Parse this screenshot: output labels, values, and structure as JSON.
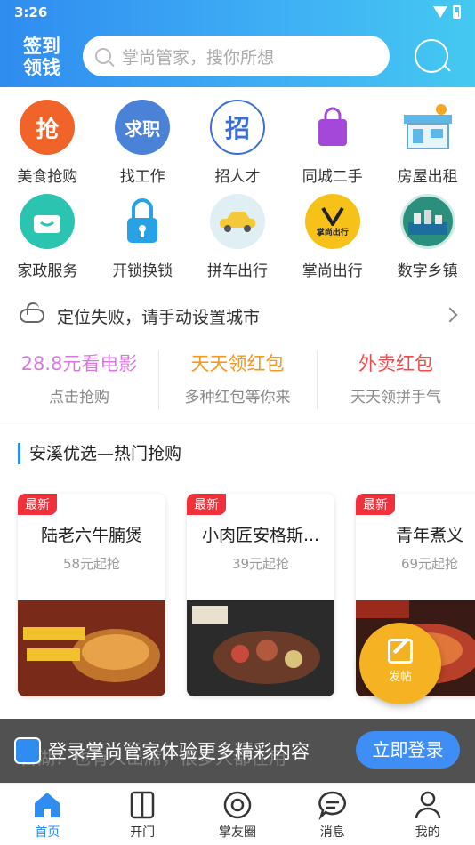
{
  "status": {
    "time": "3:26"
  },
  "header": {
    "signin_label": "签到领钱",
    "search_placeholder": "掌尚管家，搜你所想"
  },
  "grid": [
    {
      "label": "美食抢购",
      "glyph": "抢",
      "color": "#f0642a"
    },
    {
      "label": "找工作",
      "glyph": "求职",
      "color": "#4a82d8"
    },
    {
      "label": "招人才",
      "glyph": "招",
      "color": "#ffffff"
    },
    {
      "label": "同城二手",
      "glyph": "",
      "color": "#a348d8"
    },
    {
      "label": "房屋出租",
      "glyph": "",
      "color": "#5bb8e8"
    },
    {
      "label": "家政服务",
      "glyph": "",
      "color": "#2ac4b0"
    },
    {
      "label": "开锁换锁",
      "glyph": "",
      "color": "#27a2e6"
    },
    {
      "label": "拼车出行",
      "glyph": "",
      "color": "#f3c93a"
    },
    {
      "label": "掌尚出行",
      "glyph": "掌尚出行",
      "color": "#f6c21a"
    },
    {
      "label": "数字乡镇",
      "glyph": "",
      "color": "#2b8f7d"
    }
  ],
  "location": {
    "text": "定位失败，请手动设置城市"
  },
  "promos": [
    {
      "title": "28.8元看电影",
      "sub": "点击抢购",
      "color": "#d977e0"
    },
    {
      "title": "天天领红包",
      "sub": "多种红包等你来",
      "color": "#f39a1e"
    },
    {
      "title": "外卖红包",
      "sub": "天天领拼手气",
      "color": "#ee4b4b"
    }
  ],
  "section": {
    "title": "安溪优选—热门抢购"
  },
  "cards": [
    {
      "badge": "最新",
      "name": "陆老六牛腩煲",
      "price": "58元起抢"
    },
    {
      "badge": "最新",
      "name": "小肉匠安格斯...",
      "price": "39元起抢"
    },
    {
      "badge": "最新",
      "name": "青年煮义",
      "price": "69元起抢"
    }
  ],
  "fab": {
    "label": "发帖"
  },
  "banner": {
    "bg_text": "首湖：也有人出席，很多人都在用",
    "text": "登录掌尚管家体验更多精彩内容",
    "button": "立即登录"
  },
  "tabs": [
    {
      "label": "首页",
      "icon": "home-icon",
      "active": true
    },
    {
      "label": "开门",
      "icon": "door-icon",
      "active": false
    },
    {
      "label": "掌友圈",
      "icon": "circle-icon",
      "active": false
    },
    {
      "label": "消息",
      "icon": "message-icon",
      "active": false
    },
    {
      "label": "我的",
      "icon": "person-icon",
      "active": false
    }
  ],
  "colors": {
    "primary": "#2f8cf0",
    "badge": "#f0303a",
    "fab": "#f5b324"
  }
}
